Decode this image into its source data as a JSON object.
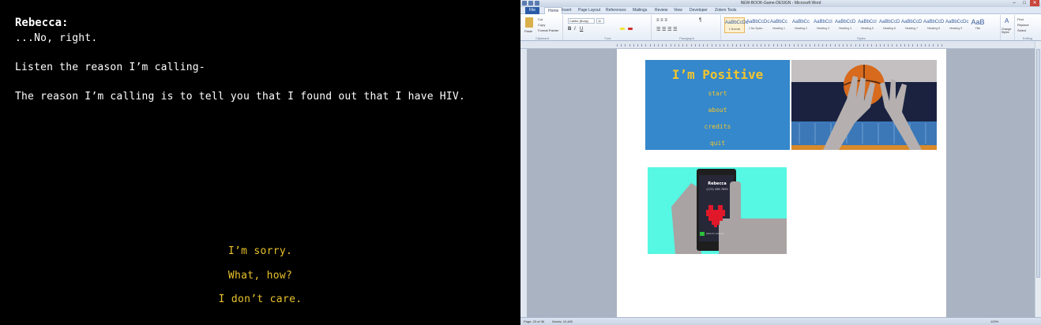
{
  "game": {
    "speaker": "Rebecca:",
    "lines": [
      "...No, right.",
      "Listen the reason I’m calling-",
      "The reason I’m calling is to tell you that I found out that I have HIV."
    ],
    "choices": [
      "I’m sorry.",
      "What, how?",
      "I don’t care."
    ],
    "choice_color": "#e8c22a"
  },
  "word": {
    "title": "NEW-BOOK-Game-DESIGN - Microsoft Word",
    "tabs": [
      "File",
      "Home",
      "Insert",
      "Page Layout",
      "References",
      "Mailings",
      "Review",
      "View",
      "Developer",
      "Zotero Tools"
    ],
    "active_tab": "Home",
    "ribbon": {
      "paste": "Paste",
      "cut": "Cut",
      "copy": "Copy",
      "format_painter": "Format Painter",
      "font_name": "Calibri (Body)",
      "font_size": "11",
      "groups": [
        "Clipboard",
        "Font",
        "Paragraph",
        "Styles",
        "Editing"
      ],
      "styles": [
        {
          "sample": "AaBbCcDc",
          "name": "1 Normal"
        },
        {
          "sample": "AaBbCcDc",
          "name": "1 No Spaci..."
        },
        {
          "sample": "AaBbCc",
          "name": "Heading 1"
        },
        {
          "sample": "AaBbCc",
          "name": "Heading 2"
        },
        {
          "sample": "AaBbCcI",
          "name": "Heading 3"
        },
        {
          "sample": "AaBbCcD",
          "name": "Heading 4"
        },
        {
          "sample": "AaBbCcI",
          "name": "Heading 5"
        },
        {
          "sample": "AaBbCcD",
          "name": "Heading 6"
        },
        {
          "sample": "AaBbCcD",
          "name": "Heading 7"
        },
        {
          "sample": "AaBbCcD",
          "name": "Heading 8"
        },
        {
          "sample": "AaBbCcDc",
          "name": "Heading 9"
        },
        {
          "sample": "AaB",
          "name": "Title"
        }
      ],
      "change_styles": "Change Styles",
      "find": "Find",
      "replace": "Replace",
      "select": "Select"
    },
    "document": {
      "shot1": {
        "title": "I’m Positive",
        "menu": [
          "start",
          "about",
          "credits",
          "quit"
        ]
      },
      "shot3": {
        "caller": "Rebecca",
        "number": "(123) 456-7890",
        "slide": "slide to answer"
      }
    },
    "status": {
      "page": "Page: 23 of 36",
      "words": "Words: 10,480",
      "zoom": "120%"
    }
  }
}
